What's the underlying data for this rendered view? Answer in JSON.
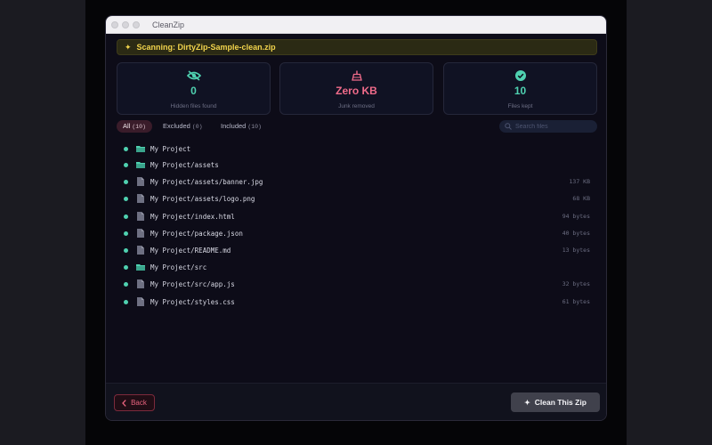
{
  "window": {
    "title": "CleanZip"
  },
  "scan": {
    "text": "Scanning: DirtyZip-Sample-clean.zip",
    "icon": "sparkle-icon"
  },
  "stats": [
    {
      "icon": "eye-slash-icon",
      "value": "0",
      "label": "Hidden files found",
      "color": "#4fd1b0"
    },
    {
      "icon": "broom-icon",
      "value": "Zero KB",
      "label": "Junk removed",
      "color": "#f06b8a"
    },
    {
      "icon": "check-circle-icon",
      "value": "10",
      "label": "Files kept",
      "color": "#4fd1b0"
    }
  ],
  "filters": {
    "all": {
      "label": "All",
      "count": "(10)"
    },
    "excluded": {
      "label": "Excluded",
      "count": "(0)"
    },
    "included": {
      "label": "Included",
      "count": "(10)"
    },
    "search_placeholder": "Search files"
  },
  "files": [
    {
      "name": "My Project",
      "type": "folder",
      "size": ""
    },
    {
      "name": "My Project/assets",
      "type": "folder",
      "size": ""
    },
    {
      "name": "My Project/assets/banner.jpg",
      "type": "file",
      "size": "137 KB"
    },
    {
      "name": "My Project/assets/logo.png",
      "type": "file",
      "size": "68 KB"
    },
    {
      "name": "My Project/index.html",
      "type": "file",
      "size": "94 bytes"
    },
    {
      "name": "My Project/package.json",
      "type": "file",
      "size": "40 bytes"
    },
    {
      "name": "My Project/README.md",
      "type": "file",
      "size": "13 bytes"
    },
    {
      "name": "My Project/src",
      "type": "folder",
      "size": ""
    },
    {
      "name": "My Project/src/app.js",
      "type": "file",
      "size": "32 bytes"
    },
    {
      "name": "My Project/styles.css",
      "type": "file",
      "size": "61 bytes"
    }
  ],
  "footer": {
    "back_label": "Back",
    "clean_label": "Clean This Zip"
  },
  "colors": {
    "accent_teal": "#4fd1b0",
    "accent_pink": "#f06b8a",
    "banner_yellow": "#f1d34c"
  }
}
